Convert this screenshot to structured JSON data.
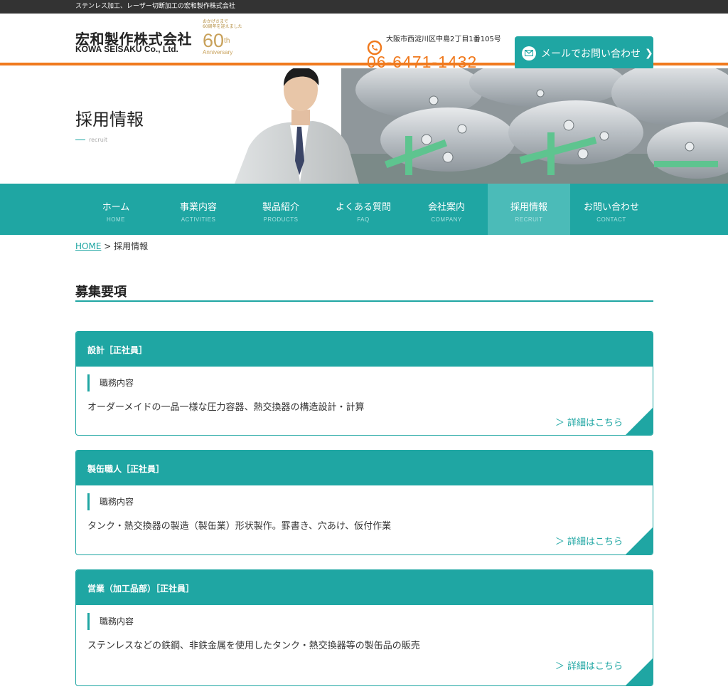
{
  "topbar": {
    "text": "ステンレス加工、レーザー切断加工の宏和製作株式会社"
  },
  "header": {
    "logo_jp": "宏和製作株式会社",
    "logo_en": "KOWA SEISAKU Co., Ltd.",
    "anniv_line1": "おかげさまで",
    "anniv_line2": "60周年を迎えました",
    "anniv_number": "60",
    "anniv_suffix": "th",
    "anniv_word": "Anniversary",
    "address": "大阪市西淀川区中島2丁目1番105号",
    "tel": "06-6471-1432",
    "tel_icon": "phone-icon",
    "mail_button": "メールでお問い合わせ",
    "mail_icon": "mail-icon"
  },
  "hero": {
    "title": "採用情報",
    "subtitle": "recruit"
  },
  "nav": [
    {
      "jp": "ホーム",
      "en": "HOME"
    },
    {
      "jp": "事業内容",
      "en": "ACTIVITIES"
    },
    {
      "jp": "製品紹介",
      "en": "PRODUCTS"
    },
    {
      "jp": "よくある質問",
      "en": "FAQ"
    },
    {
      "jp": "会社案内",
      "en": "COMPANY"
    },
    {
      "jp": "採用情報",
      "en": "RECRUIT"
    },
    {
      "jp": "お問い合わせ",
      "en": "CONTACT"
    }
  ],
  "breadcrumb": {
    "home": "HOME",
    "sep": ">",
    "current": "採用情報"
  },
  "section": {
    "title": "募集要項"
  },
  "jobs": [
    {
      "title": "設計［正社員］",
      "label": "職務内容",
      "text": "オーダーメイドの一品一様な圧力容器、熱交換器の構造設計・計算",
      "link": "＞ 詳細はこちら"
    },
    {
      "title": "製缶職人［正社員］",
      "label": "職務内容",
      "text": "タンク・熱交換器の製造（製缶業）形状製作。罫書き、穴あけ、仮付作業",
      "link": "＞ 詳細はこちら"
    },
    {
      "title": "営業（加工品部）［正社員］",
      "label": "職務内容",
      "text": "ステンレスなどの鉄鋼、非鉄金属を使用したタンク・熱交換器等の製缶品の販売",
      "link": "＞ 詳細はこちら"
    }
  ],
  "colors": {
    "accent": "#1fa6a3",
    "orange": "#f07a1e",
    "nav_active": "#4bbbb8"
  }
}
